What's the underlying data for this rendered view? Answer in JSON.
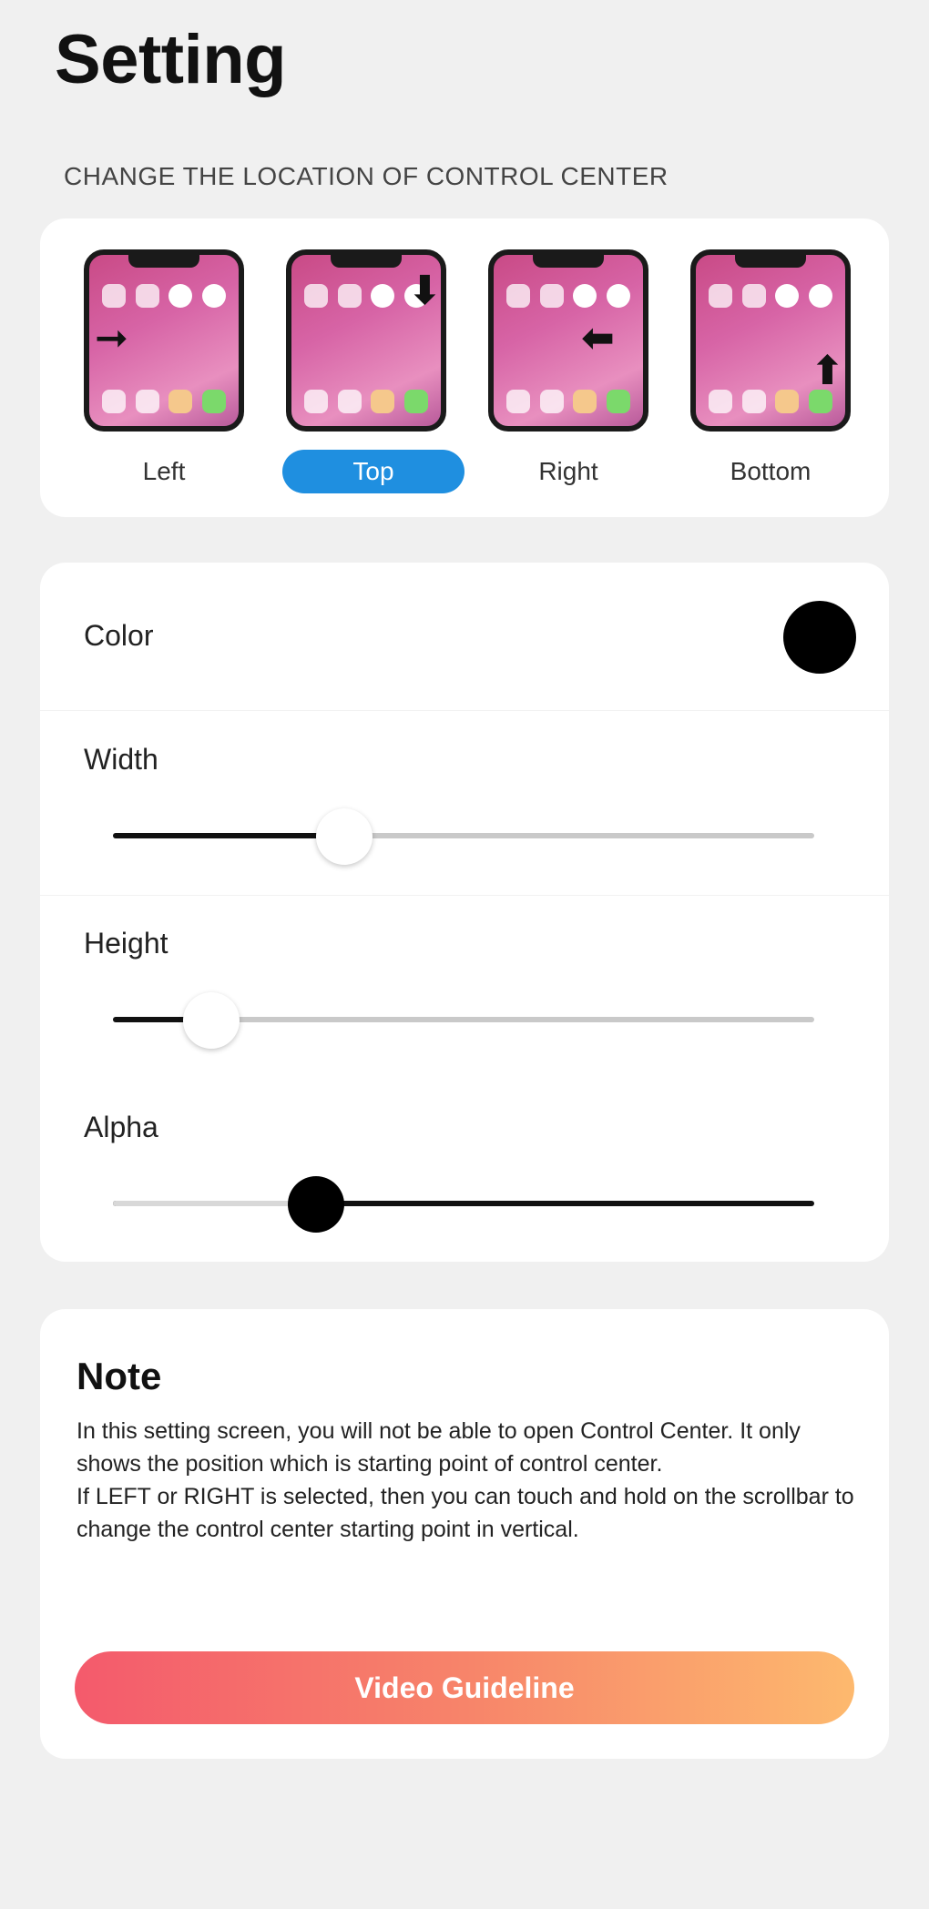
{
  "page": {
    "title": "Setting"
  },
  "location": {
    "heading": "CHANGE THE LOCATION OF CONTROL CENTER",
    "selected": "Top",
    "options": [
      {
        "label": "Left",
        "arrow": "right-arrow-icon"
      },
      {
        "label": "Top",
        "arrow": "down-arrow-icon"
      },
      {
        "label": "Right",
        "arrow": "left-arrow-icon"
      },
      {
        "label": "Bottom",
        "arrow": "up-arrow-icon"
      }
    ]
  },
  "controls": {
    "color": {
      "label": "Color",
      "value": "#000000"
    },
    "width": {
      "label": "Width",
      "value_fraction": 0.33
    },
    "height": {
      "label": "Height",
      "value_fraction": 0.14
    },
    "alpha": {
      "label": "Alpha",
      "value_fraction": 0.29
    }
  },
  "note": {
    "title": "Note",
    "text": "In this setting screen, you will not be able to open Control Center. It only shows the position which is starting point of control center.\nIf LEFT or RIGHT is selected, then you can touch and hold on the scrollbar to change the control center starting point in vertical.",
    "button_label": "Video Guideline"
  },
  "colors": {
    "accent": "#1f8fe0",
    "gradient_start": "#f45a6c",
    "gradient_end": "#fdb96e"
  }
}
